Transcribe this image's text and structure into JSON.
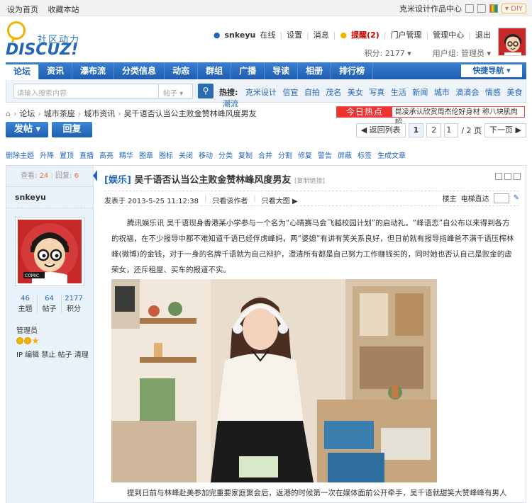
{
  "topbar": {
    "links": [
      "设为首页",
      "收藏本站"
    ],
    "right_text": "克米设计作品中心",
    "diy": "DIY"
  },
  "logo": {
    "tagline": "社区动力",
    "word": "DISCUZ!"
  },
  "user": {
    "name": "snkeyu",
    "status": "在线",
    "links": [
      "设置",
      "消息"
    ],
    "remind": "提醒(2)",
    "links2": [
      "门户管理",
      "管理中心",
      "退出"
    ],
    "points": "积分: 2177",
    "group": "用户组: 管理员"
  },
  "nav": {
    "items": [
      "论坛",
      "资讯",
      "瀑布流",
      "分类信息",
      "动态",
      "群组",
      "广播",
      "导读",
      "相册",
      "排行榜"
    ],
    "quick": "快捷导航"
  },
  "search": {
    "placeholder": "请输入搜索内容",
    "scope": "帖子",
    "hot_label": "热搜:",
    "hot": [
      "克米设计",
      "信宜",
      "自拍",
      "茂名",
      "美女",
      "写真",
      "生活",
      "新闻",
      "城市",
      "滴滴会",
      "情感",
      "美食",
      "潮流"
    ]
  },
  "breadcrumb": [
    "论坛",
    "城市茶座",
    "城市资讯",
    "吴千语否认当公主败金赞林峰风度男友"
  ],
  "hotad": {
    "tag": "今日热点",
    "text": "昆凌承认欣赏周杰伦好身材 称八块肌肉超"
  },
  "buttons": {
    "post": "发帖",
    "reply": "回复"
  },
  "pager": {
    "back": "返回列表",
    "p1": "1",
    "p2": "2",
    "input": "1",
    "total": "/ 2 页",
    "next": "下一页"
  },
  "modbar": [
    "删除主题",
    "升降",
    "置顶",
    "直播",
    "高亮",
    "精华",
    "图章",
    "图标",
    "关闭",
    "移动",
    "分类",
    "复制",
    "合并",
    "分割",
    "修复",
    "警告",
    "屏蔽",
    "标签",
    "生成文章"
  ],
  "side": {
    "view_label": "查看:",
    "views": "24",
    "reply_label": "回复:",
    "replies": "6",
    "username": "snkeyu",
    "topics": "46",
    "topics_label": "主题",
    "posts": "64",
    "posts_label": "帖子",
    "points": "2177",
    "points_label": "积分",
    "group": "管理员",
    "ops": "IP 编辑 禁止 帖子 清理"
  },
  "post": {
    "category": "[娱乐]",
    "title": "吴千语否认当公主败金赞林峰风度男友",
    "copy": "[复制链接]",
    "posted": "发表于 2013-5-25 11:12:38",
    "author_only": "只看该作者",
    "big_image": "只看大图",
    "floor": "楼主",
    "elevator": "电梯直达",
    "p1": "腾讯娱乐讯 吴千语现身香港某小学参与一个名为“心晴赛马会飞越校园计划”的启动礼。“峰语恋”自公布以来得到各方的祝福，在不少报导中都不难知道千语已经俘虏峰妈，两“婆媳”有讲有笑关系良好，但日前就有报导指峰爸不满千语压榨林峰(微博)的金钱，对于一身的名牌千语就为自己辩护，澄清所有都是自己努力工作赚钱买的，同时她也否认自己是败金的虚荣女，还斥租屋、买车的报道不实。",
    "p2": "提到日前与林峰赴美参加完重要家庭聚会后，返港的时候第一次在媒体面前公开牵手，吴千语就甜笑大赞峰峰有男人"
  },
  "colors": {
    "brand": "#2366b8",
    "accent": "#e33333",
    "highlight": "#f26c4f"
  }
}
